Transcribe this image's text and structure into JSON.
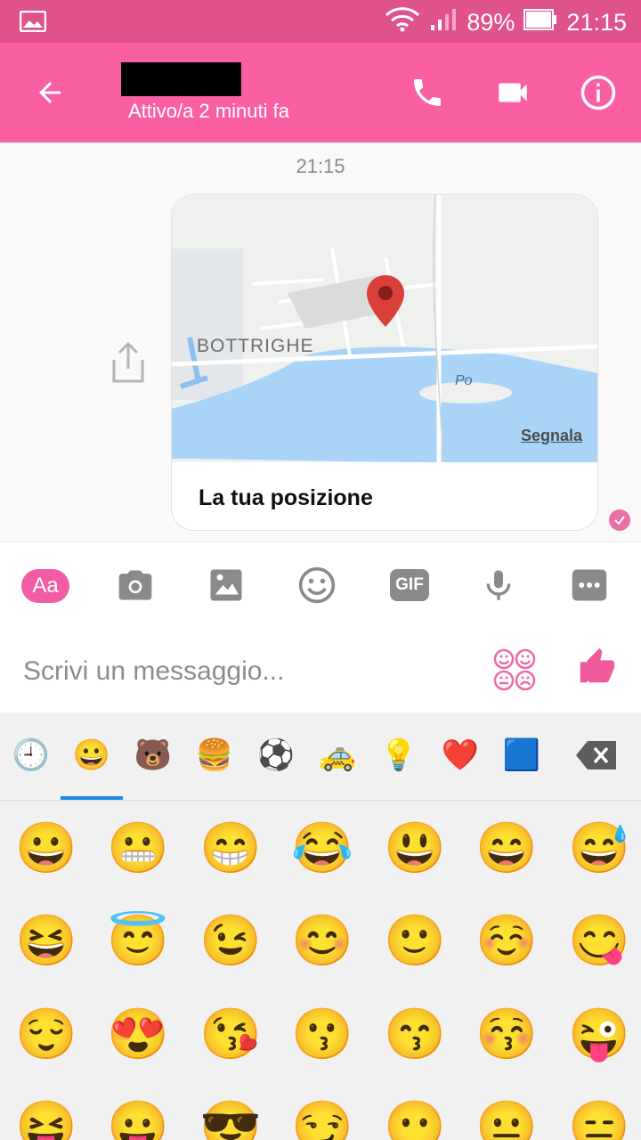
{
  "status_bar": {
    "battery": "89%",
    "time": "21:15"
  },
  "header": {
    "subtitle": "Attivo/a 2 minuti fa"
  },
  "chat": {
    "timestamp": "21:15",
    "location_card": {
      "map_label": "BOTTRIGHE",
      "river_label": "Po",
      "report_link": "Segnala",
      "title": "La tua posizione"
    }
  },
  "toolbar": {
    "aa_label": "Aa",
    "gif_label": "GIF"
  },
  "input": {
    "placeholder": "Scrivi un messaggio..."
  },
  "emoji_categories": [
    "🕘",
    "😀",
    "🐻",
    "🍔",
    "⚽",
    "🚕",
    "💡",
    "❤️",
    "🟦"
  ],
  "emoji_grid": [
    [
      "😀",
      "😬",
      "😁",
      "😂",
      "😃",
      "😄",
      "😅"
    ],
    [
      "😆",
      "😇",
      "😉",
      "😊",
      "🙂",
      "☺️",
      "😋"
    ],
    [
      "😌",
      "😍",
      "😘",
      "😗",
      "😙",
      "😚",
      "😜"
    ],
    [
      "😝",
      "😛",
      "😎",
      "😏",
      "😶",
      "😐",
      "😑"
    ]
  ],
  "colors": {
    "accent": "#fb5fa3",
    "status_bar": "#e0528c"
  }
}
